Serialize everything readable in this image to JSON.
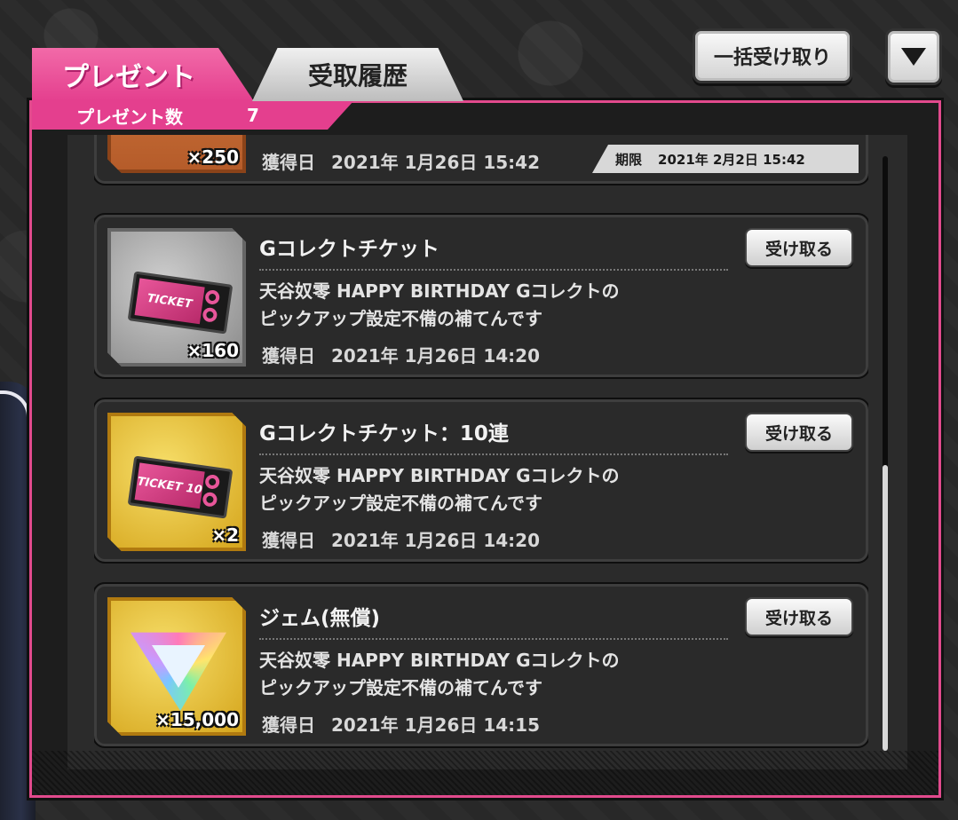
{
  "header": {
    "bulk_receive_label": "一括受け取り",
    "menu_icon": "triangle-down"
  },
  "tabs": {
    "present_label": "プレゼント",
    "history_label": "受取履歴"
  },
  "present_count": {
    "label": "プレゼント数",
    "value": "7"
  },
  "receive_button_label": "受け取る",
  "items": [
    {
      "title": "",
      "quantity": "×250",
      "acquired_label": "獲得日",
      "acquired_date": "2021年 1月26日 15:42",
      "expiry_label": "期限",
      "expiry_date": "2021年 2月2日 15:42",
      "thumb": "orange"
    },
    {
      "title": "Gコレクトチケット",
      "desc_line1": "天谷奴零 HAPPY BIRTHDAY Gコレクトの",
      "desc_line2": "ピックアップ設定不備の補てんです",
      "quantity": "×160",
      "acquired_label": "獲得日",
      "acquired_date": "2021年 1月26日 14:20",
      "ticket_text": "TICKET",
      "thumb": "silver"
    },
    {
      "title": "Gコレクトチケット：10連",
      "desc_line1": "天谷奴零 HAPPY BIRTHDAY Gコレクトの",
      "desc_line2": "ピックアップ設定不備の補てんです",
      "quantity": "×2",
      "acquired_label": "獲得日",
      "acquired_date": "2021年 1月26日 14:20",
      "ticket_text": "TICKET 10",
      "thumb": "gold"
    },
    {
      "title": "ジェム(無償)",
      "desc_line1": "天谷奴零 HAPPY BIRTHDAY Gコレクトの",
      "desc_line2": "ピックアップ設定不備の補てんです",
      "quantity": "×15,000",
      "acquired_label": "獲得日",
      "acquired_date": "2021年 1月26日 14:15",
      "thumb": "gold"
    }
  ],
  "colors": {
    "accent_pink": "#e43f8e",
    "panel_bg": "#2b2b2b"
  }
}
